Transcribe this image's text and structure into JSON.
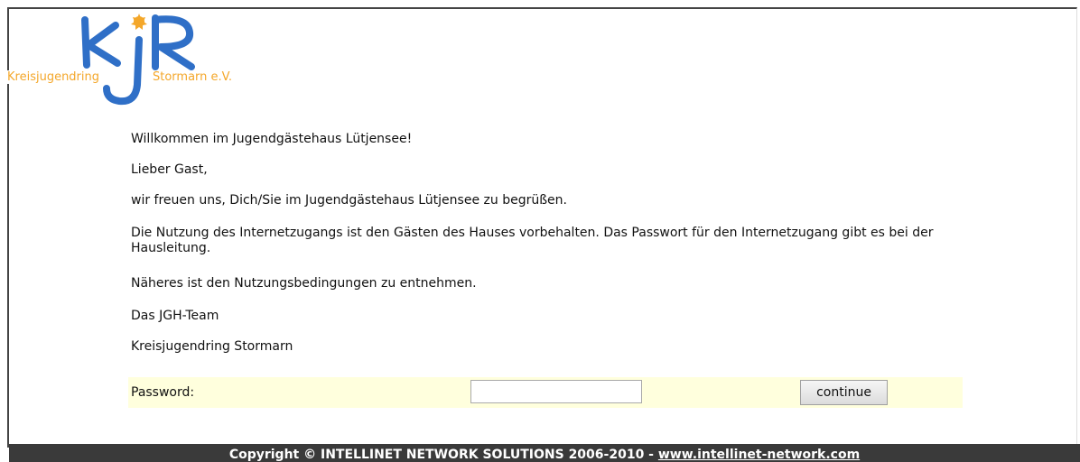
{
  "logo": {
    "icon": "kjr-logo",
    "left_text": "Kreisjugendring",
    "right_text": "Stormarn e.V.",
    "colors": {
      "blue": "#2f6fc7",
      "orange": "#f4a72a"
    }
  },
  "content": {
    "welcome": "Willkommen im Jugendgästehaus Lütjensee!",
    "greeting": "Lieber Gast,",
    "intro": "wir freuen uns, Dich/Sie im Jugendgästehaus Lütjensee zu begrüßen.",
    "usage": "Die Nutzung des Internetzugangs ist den Gästen des Hauses vorbehalten. Das Passwort für den Internetzugang gibt es bei der Hausleitung.",
    "details": "Näheres ist den Nutzungsbedingungen zu entnehmen.",
    "team": "Das JGH-Team",
    "org": "Kreisjugendring Stormarn"
  },
  "form": {
    "password_label": "Password:",
    "password_value": "",
    "continue_label": "continue",
    "row_color": "#ffffdd"
  },
  "footer": {
    "copyright": "Copyright © INTELLINET NETWORK SOLUTIONS 2006-2010 - ",
    "link_text": "www.intellinet-network.com",
    "background": "#3a3a3a"
  }
}
